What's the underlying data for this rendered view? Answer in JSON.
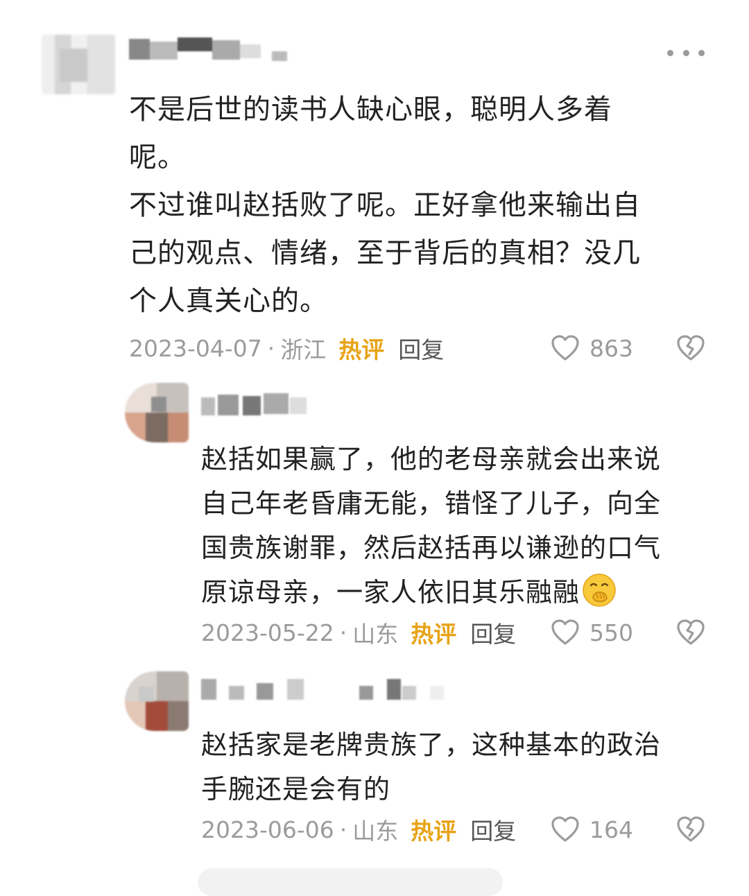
{
  "comment_main": {
    "username": "",
    "text": "不是后世的读书人缺心眼，聪明人多着\n呢。\n不过谁叫赵括败了呢。正好拿他来输出自\n己的观点、情绪，至于背后的真相？没几\n个人真关心的。",
    "date": "2023-04-07",
    "location": "浙江",
    "hot_label": "热评",
    "reply_label": "回复",
    "likes": "863",
    "more_icon": "more-dots-icon"
  },
  "replies": [
    {
      "text": "赵括如果赢了，他的老母亲就会出来说\n自己年老昏庸无能，错怪了儿子，向全\n国贵族谢罪，然后赵括再以谦逊的口气\n原谅母亲，一家人依旧其乐融融",
      "emoji": "hand-over-mouth-emoji",
      "date": "2023-05-22",
      "location": "山东",
      "hot_label": "热评",
      "reply_label": "回复",
      "likes": "550"
    },
    {
      "text": "赵括家是老牌贵族了，这种基本的政治\n手腕还是会有的",
      "date": "2023-06-06",
      "location": "山东",
      "hot_label": "热评",
      "reply_label": "回复",
      "likes": "164"
    }
  ],
  "separator": "·",
  "colors": {
    "hot": "#e7a316",
    "meta": "#9b9b9b",
    "text": "#222222"
  }
}
